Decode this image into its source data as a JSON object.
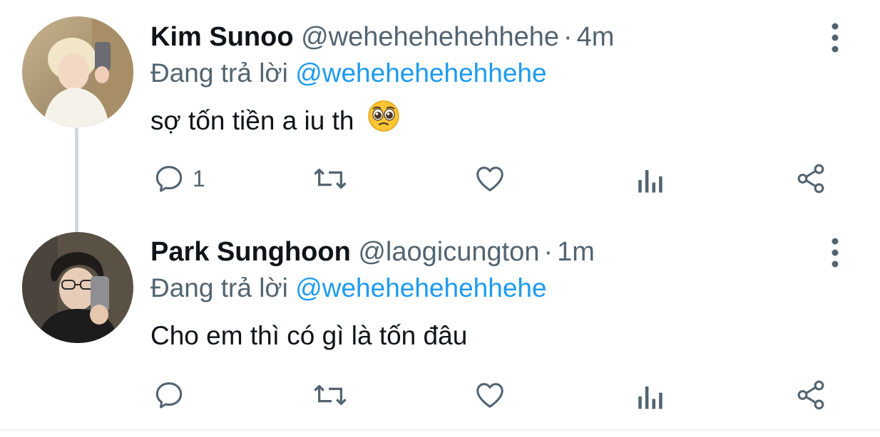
{
  "tweets": [
    {
      "name": "Kim Sunoo",
      "handle": "@wehehehehehhehe",
      "separator": "·",
      "time": "4m",
      "reply_prefix": "Đang trả lời",
      "reply_to": "@wehehehehehhehe",
      "text": "sợ tốn tiền a iu th",
      "emoji": "pleading-face",
      "reply_count": "1"
    },
    {
      "name": "Park Sunghoon",
      "handle": "@laogicungton",
      "separator": "·",
      "time": "1m",
      "reply_prefix": "Đang trả lời",
      "reply_to": "@wehehehehehhehe",
      "text": "Cho em thì có gì là tốn đâu",
      "reply_count": ""
    }
  ],
  "colors": {
    "primary_text": "#0f1419",
    "secondary_text": "#536471",
    "link": "#1d9bf0",
    "thread_line": "#cfd9de"
  },
  "icons": [
    "reply-icon",
    "retweet-icon",
    "like-icon",
    "analytics-icon",
    "share-icon",
    "more-options-icon"
  ]
}
